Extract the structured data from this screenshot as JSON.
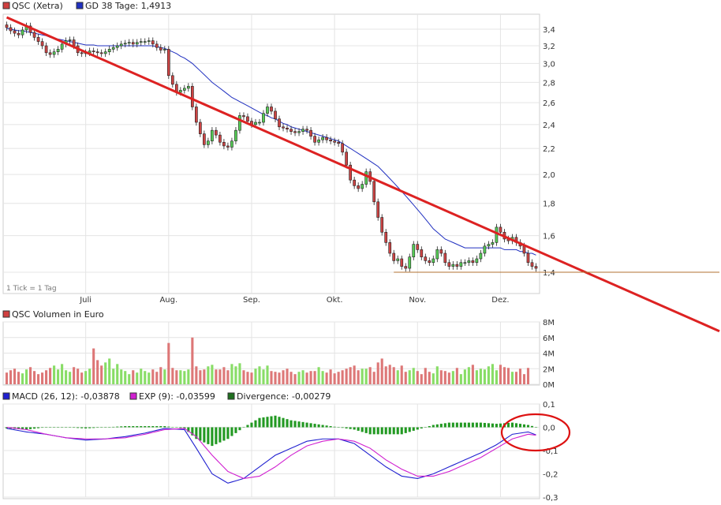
{
  "price_panel": {
    "legend": [
      {
        "label": "QSC (Xetra)",
        "color": "#d04040"
      },
      {
        "label": "GD 38 Tage: 1,4913",
        "color": "#2030c0"
      }
    ],
    "tick_note": "1 Tick = 1 Tag",
    "y_ticks": [
      "3,4",
      "3,2",
      "3,0",
      "2,8",
      "2,6",
      "2,4",
      "2,2",
      "2,0",
      "1,8",
      "1,6",
      "1,4"
    ],
    "x_ticks": [
      "Juli",
      "Aug.",
      "Sep.",
      "Okt.",
      "Nov.",
      "Dez."
    ]
  },
  "volume_panel": {
    "legend": {
      "label": "QSC Volumen in Euro",
      "color": "#d04040"
    },
    "y_ticks": [
      "8M",
      "6M",
      "4M",
      "2M",
      "0M"
    ]
  },
  "macd_panel": {
    "legend": [
      {
        "label": "MACD (26, 12): -0,03878",
        "color": "#2020d0"
      },
      {
        "label": "EXP (9): -0,03599",
        "color": "#d020d0"
      },
      {
        "label": "Divergence: -0,00279",
        "color": "#207020"
      }
    ],
    "y_ticks": [
      "0,1",
      "0,0",
      "-0,1",
      "-0,2",
      "-0,3"
    ]
  },
  "chart_data": [
    {
      "type": "candlestick",
      "series_name": "QSC (Xetra)",
      "y_scale": "log",
      "ylim": [
        1.31,
        3.55
      ],
      "x_month_labels": [
        "Juli",
        "Aug.",
        "Sep.",
        "Okt.",
        "Nov.",
        "Dez."
      ],
      "x_month_index": [
        20,
        41,
        62,
        83,
        104,
        125
      ],
      "close": [
        3.42,
        3.38,
        3.35,
        3.33,
        3.39,
        3.44,
        3.36,
        3.3,
        3.25,
        3.2,
        3.12,
        3.1,
        3.13,
        3.16,
        3.22,
        3.26,
        3.27,
        3.2,
        3.12,
        3.11,
        3.12,
        3.14,
        3.13,
        3.12,
        3.11,
        3.13,
        3.16,
        3.18,
        3.2,
        3.22,
        3.23,
        3.24,
        3.22,
        3.24,
        3.25,
        3.25,
        3.26,
        3.22,
        3.18,
        3.15,
        3.16,
        2.87,
        2.78,
        2.7,
        2.72,
        2.74,
        2.76,
        2.56,
        2.42,
        2.32,
        2.23,
        2.26,
        2.35,
        2.31,
        2.25,
        2.22,
        2.21,
        2.26,
        2.35,
        2.48,
        2.47,
        2.43,
        2.4,
        2.42,
        2.42,
        2.5,
        2.56,
        2.52,
        2.45,
        2.38,
        2.37,
        2.36,
        2.34,
        2.33,
        2.34,
        2.36,
        2.35,
        2.3,
        2.25,
        2.27,
        2.29,
        2.27,
        2.26,
        2.25,
        2.24,
        2.17,
        2.07,
        1.96,
        1.92,
        1.9,
        1.93,
        2.02,
        1.95,
        1.81,
        1.71,
        1.62,
        1.56,
        1.5,
        1.46,
        1.47,
        1.43,
        1.42,
        1.48,
        1.55,
        1.52,
        1.48,
        1.46,
        1.45,
        1.47,
        1.52,
        1.5,
        1.45,
        1.43,
        1.44,
        1.43,
        1.45,
        1.45,
        1.46,
        1.45,
        1.47,
        1.5,
        1.54,
        1.55,
        1.56,
        1.65,
        1.62,
        1.58,
        1.57,
        1.59,
        1.56,
        1.54,
        1.5,
        1.45,
        1.43,
        1.42
      ],
      "ma38_label": "GD 38 Tage: 1,4913",
      "ma38": [
        3.41,
        3.4,
        3.39,
        3.38,
        3.38,
        3.37,
        3.36,
        3.35,
        3.34,
        3.33,
        3.32,
        3.3,
        3.29,
        3.28,
        3.27,
        3.26,
        3.25,
        3.24,
        3.23,
        3.22,
        3.21,
        3.21,
        3.21,
        3.2,
        3.2,
        3.2,
        3.2,
        3.2,
        3.2,
        3.2,
        3.2,
        3.2,
        3.2,
        3.2,
        3.2,
        3.2,
        3.2,
        3.2,
        3.19,
        3.18,
        3.17,
        3.15,
        3.13,
        3.11,
        3.08,
        3.06,
        3.03,
        3.0,
        2.96,
        2.92,
        2.88,
        2.84,
        2.8,
        2.77,
        2.74,
        2.71,
        2.68,
        2.65,
        2.63,
        2.61,
        2.59,
        2.57,
        2.55,
        2.53,
        2.51,
        2.49,
        2.48,
        2.46,
        2.45,
        2.43,
        2.41,
        2.4,
        2.38,
        2.37,
        2.36,
        2.35,
        2.34,
        2.33,
        2.32,
        2.31,
        2.3,
        2.29,
        2.28,
        2.27,
        2.26,
        2.24,
        2.22,
        2.2,
        2.18,
        2.16,
        2.14,
        2.12,
        2.1,
        2.08,
        2.06,
        2.03,
        2.0,
        1.97,
        1.94,
        1.91,
        1.88,
        1.85,
        1.82,
        1.79,
        1.76,
        1.73,
        1.7,
        1.67,
        1.64,
        1.62,
        1.6,
        1.58,
        1.57,
        1.56,
        1.55,
        1.54,
        1.53,
        1.53,
        1.53,
        1.53,
        1.53,
        1.53,
        1.53,
        1.53,
        1.53,
        1.53,
        1.52,
        1.52,
        1.52,
        1.52,
        1.51,
        1.51,
        1.5,
        1.5,
        1.49
      ],
      "trendline": {
        "from": [
          0,
          3.55
        ],
        "to": [
          154,
          1.335
        ]
      },
      "support_level": 1.4
    },
    {
      "type": "bar",
      "series_name": "QSC Volumen in Euro",
      "unit": "M",
      "ylim": [
        0,
        8
      ],
      "values": [
        1.5,
        1.8,
        2.0,
        1.6,
        1.4,
        1.9,
        2.2,
        1.7,
        1.3,
        1.5,
        1.8,
        2.1,
        2.4,
        1.9,
        2.6,
        1.8,
        1.6,
        2.2,
        2.0,
        1.5,
        1.7,
        2.0,
        4.6,
        3.1,
        2.4,
        2.8,
        3.3,
        2.0,
        2.6,
        1.9,
        1.7,
        1.3,
        1.8,
        1.5,
        2.0,
        1.7,
        1.5,
        1.9,
        1.6,
        2.2,
        1.9,
        5.3,
        2.1,
        1.8,
        1.8,
        1.7,
        1.9,
        6.0,
        2.3,
        1.8,
        1.9,
        2.3,
        2.5,
        1.9,
        1.9,
        2.2,
        1.8,
        2.6,
        2.3,
        2.7,
        1.8,
        1.6,
        1.5,
        2.0,
        2.3,
        1.9,
        2.4,
        1.7,
        1.6,
        1.5,
        1.8,
        2.0,
        1.6,
        1.3,
        1.6,
        1.8,
        1.5,
        1.7,
        1.7,
        2.2,
        1.7,
        1.5,
        1.9,
        1.4,
        1.6,
        1.8,
        2.0,
        2.2,
        2.4,
        1.8,
        2.0,
        2.0,
        2.2,
        1.6,
        2.8,
        3.3,
        2.3,
        2.5,
        2.2,
        1.8,
        2.4,
        1.6,
        1.8,
        2.1,
        1.7,
        1.3,
        2.1,
        1.6,
        1.4,
        2.3,
        1.8,
        1.7,
        1.5,
        1.7,
        2.1,
        1.3,
        1.9,
        2.2,
        2.5,
        1.8,
        2.0,
        1.9,
        2.3,
        2.6,
        1.8,
        2.5,
        2.2,
        2.1,
        1.6,
        1.6,
        2.0,
        1.3,
        2.1
      ]
    },
    {
      "type": "line",
      "ylim": [
        -0.3,
        0.1
      ],
      "series": [
        {
          "name": "MACD (26, 12)",
          "last_value": -0.03878,
          "color": "#2020d0",
          "x": [
            0,
            5,
            10,
            15,
            20,
            25,
            30,
            35,
            40,
            45,
            48,
            52,
            56,
            60,
            64,
            68,
            72,
            76,
            80,
            84,
            88,
            92,
            96,
            100,
            104,
            108,
            112,
            116,
            120,
            124,
            128,
            132,
            135
          ],
          "y": [
            -0.005,
            -0.02,
            -0.03,
            -0.045,
            -0.055,
            -0.05,
            -0.04,
            -0.025,
            -0.005,
            -0.01,
            -0.09,
            -0.2,
            -0.24,
            -0.22,
            -0.17,
            -0.12,
            -0.09,
            -0.06,
            -0.05,
            -0.05,
            -0.07,
            -0.12,
            -0.17,
            -0.21,
            -0.22,
            -0.2,
            -0.17,
            -0.14,
            -0.11,
            -0.075,
            -0.03,
            -0.02,
            -0.039
          ]
        },
        {
          "name": "EXP (9)",
          "last_value": -0.03599,
          "color": "#d020d0",
          "x": [
            0,
            5,
            10,
            15,
            20,
            25,
            30,
            35,
            40,
            45,
            48,
            52,
            56,
            60,
            64,
            68,
            72,
            76,
            80,
            84,
            88,
            92,
            96,
            100,
            104,
            108,
            112,
            116,
            120,
            124,
            128,
            132,
            135
          ],
          "y": [
            0.0,
            -0.01,
            -0.03,
            -0.045,
            -0.05,
            -0.05,
            -0.045,
            -0.03,
            -0.01,
            -0.005,
            -0.04,
            -0.12,
            -0.19,
            -0.22,
            -0.21,
            -0.17,
            -0.12,
            -0.08,
            -0.06,
            -0.05,
            -0.06,
            -0.09,
            -0.14,
            -0.18,
            -0.21,
            -0.21,
            -0.19,
            -0.16,
            -0.13,
            -0.09,
            -0.05,
            -0.03,
            -0.036
          ]
        }
      ],
      "divergence": {
        "name": "Divergence",
        "last_value": -0.00279,
        "color": "#207020",
        "x": [
          0,
          5,
          10,
          15,
          20,
          25,
          30,
          35,
          40,
          45,
          48,
          52,
          56,
          60,
          64,
          68,
          72,
          76,
          80,
          84,
          88,
          92,
          96,
          100,
          104,
          108,
          112,
          116,
          120,
          124,
          128,
          132,
          135
        ],
        "y": [
          -0.005,
          -0.01,
          0.0,
          0.0,
          -0.005,
          0.0,
          0.005,
          0.005,
          0.005,
          -0.005,
          -0.05,
          -0.08,
          -0.05,
          0.0,
          0.04,
          0.05,
          0.03,
          0.02,
          0.01,
          0.0,
          -0.01,
          -0.03,
          -0.03,
          -0.03,
          -0.01,
          0.01,
          0.02,
          0.02,
          0.02,
          0.015,
          0.02,
          0.01,
          -0.003
        ]
      }
    }
  ]
}
